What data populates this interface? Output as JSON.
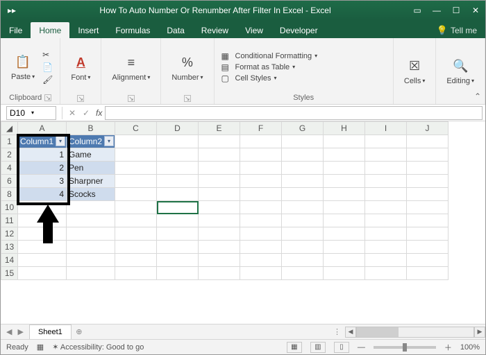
{
  "window": {
    "title": "How To Auto Number Or Renumber After Filter In Excel  -  Excel"
  },
  "tabs": {
    "file": "File",
    "home": "Home",
    "insert": "Insert",
    "formulas": "Formulas",
    "data": "Data",
    "review": "Review",
    "view": "View",
    "developer": "Developer",
    "tellme": "Tell me"
  },
  "ribbon": {
    "clipboard": {
      "label": "Clipboard",
      "paste": "Paste"
    },
    "font": {
      "label": "Font"
    },
    "alignment": {
      "label": "Alignment"
    },
    "number": {
      "label": "Number"
    },
    "styles": {
      "label": "Styles",
      "cond": "Conditional Formatting",
      "table": "Format as Table",
      "cell": "Cell Styles"
    },
    "cells": {
      "label": "Cells"
    },
    "editing": {
      "label": "Editing"
    }
  },
  "namebox": "D10",
  "fx_label": "fx",
  "formula_value": "",
  "columns": [
    "A",
    "B",
    "C",
    "D",
    "E",
    "F",
    "G",
    "H",
    "I",
    "J"
  ],
  "visible_rows": [
    "1",
    "2",
    "4",
    "6",
    "8",
    "10",
    "11",
    "12",
    "13",
    "14",
    "15"
  ],
  "table": {
    "h1": "Column1",
    "h2": "Column2",
    "rows": [
      {
        "n": "1",
        "v": "Game"
      },
      {
        "n": "2",
        "v": "Pen"
      },
      {
        "n": "3",
        "v": "Sharpner"
      },
      {
        "n": "4",
        "v": "Scocks"
      }
    ]
  },
  "sheet_tab": "Sheet1",
  "status": {
    "ready": "Ready",
    "acc": "Accessibility: Good to go",
    "zoom": "100%"
  }
}
